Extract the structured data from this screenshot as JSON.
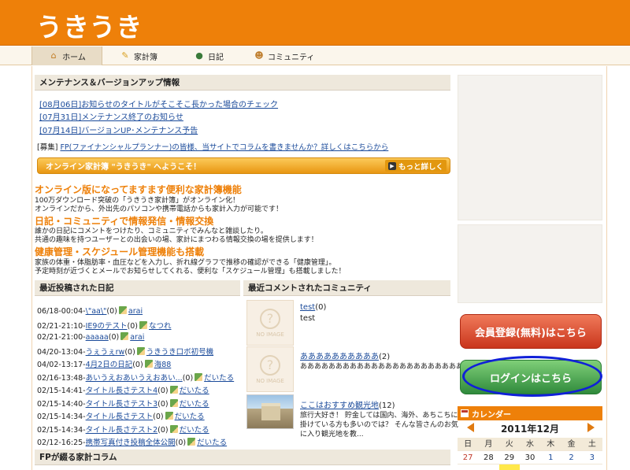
{
  "header": {
    "logo": "うきうき"
  },
  "nav": [
    {
      "label": "ホーム",
      "icon": "home-icon"
    },
    {
      "label": "家計簿",
      "icon": "pencil-icon"
    },
    {
      "label": "日記",
      "icon": "person-icon"
    },
    {
      "label": "コミュニティ",
      "icon": "community-icon"
    }
  ],
  "maintenance": {
    "title": "メンテナンス＆バージョンアップ情報",
    "items": [
      "[08月06日]お知らせのタイトルがそこそこ長かった場合のチェック",
      "[07月31日]メンテナンス終了のお知らせ",
      "[07月14日]バージョンUP･メンテナンス予告"
    ],
    "recruit_prefix": "[募集] ",
    "recruit_link": "FP(ファイナンシャルプランナー)の皆様、当サイトでコラムを書きませんか？詳しくはこちらから"
  },
  "banner": {
    "text": "オンライン家計簿 \"うきうき\" へようこそ！",
    "more": "もっと詳しく"
  },
  "features": [
    {
      "heading": "オンライン版になってますます便利な家計簿機能",
      "lines": [
        "100万ダウンロード突破の「うきうき家計簿」がオンライン化！",
        "オンラインだから、外出先のパソコンや携帯電話からも家計入力が可能です！"
      ]
    },
    {
      "heading": "日記・コミュニティで情報発信・情報交換",
      "lines": [
        "誰かの日記にコメントをつけたり、コミュニティでみんなと雑談したり。",
        "共通の趣味を持つユーザーとの出会いの場、家計にまつわる情報交換の場を提供します！"
      ]
    },
    {
      "heading": "健康管理・スケジュール管理機能も搭載",
      "lines": [
        "家族の体重・体脂肪率・血圧などを入力し、折れ線グラフで推移の確認ができる「健康管理」。",
        "予定時刻が近づくとメールでお知らせしてくれる、便利な「スケジュール管理」も搭載しました！"
      ]
    }
  ],
  "diary": {
    "title": "最近投稿された日記",
    "rows": [
      {
        "date": "06/18-00:04-",
        "title": "\\\"aa\\\"",
        "count": "(0)",
        "user": "arai"
      },
      {
        "date": "02/21-21:10-",
        "title": "IE9のテスト",
        "count": "(0)",
        "user": "なつれ"
      },
      {
        "date": "02/21-21:00-",
        "title": "aaaaa",
        "count": "(0)",
        "user": "arai"
      },
      {
        "date": "04/20-13:04-",
        "title": "うぇうぇrw",
        "count": "(0)",
        "user": "うきうき口ボ初号機"
      },
      {
        "date": "04/02-13:17-",
        "title": "4月2日の日記",
        "count": "(0)",
        "user": "海88"
      },
      {
        "date": "02/16-13:48-",
        "title": "あいうえおあいうえおあい...",
        "count": "(0)",
        "user": "だいたる"
      },
      {
        "date": "02/15-14:41-",
        "title": "タイトル長さテスト4",
        "count": "(0)",
        "user": "だいたる"
      },
      {
        "date": "02/15-14:40-",
        "title": "タイトル長さテスト3",
        "count": "(0)",
        "user": "だいたる"
      },
      {
        "date": "02/15-14:34-",
        "title": "タイトル長さテスト",
        "count": "(0)",
        "user": "だいたる"
      },
      {
        "date": "02/15-14:34-",
        "title": "タイトル長さテスト2",
        "count": "(0)",
        "user": "だいたる"
      },
      {
        "date": "02/12-16:25-",
        "title": "携帯写真付き投稿全体公開",
        "count": "(0)",
        "user": "だいたる"
      }
    ]
  },
  "community": {
    "title": "最近コメントされたコミュニティ",
    "no_image": "NO IMAGE",
    "items": [
      {
        "name": "test",
        "count": "(0)",
        "desc": "test"
      },
      {
        "name": "ああああああああああ",
        "count": "(2)",
        "desc": "ああああああああああああああああああああああああ"
      },
      {
        "name": "ここはおすすめ観光地",
        "count": "(12)",
        "desc1": "旅行大好き！ 貯金しては国内、海外、あちこちに出",
        "desc2": "掛けている方も多いのでは？ そんな皆さんのお気",
        "desc3": "に入り観光地を教..."
      }
    ]
  },
  "column": {
    "title": "FPが綴る家計コラム"
  },
  "sidebar": {
    "register": "会員登録(無料)はこちら",
    "login": "ログインはこちら"
  },
  "calendar": {
    "label": "カレンダー",
    "month": "2011年12月",
    "dow": [
      "日",
      "月",
      "火",
      "水",
      "木",
      "金",
      "土"
    ],
    "week1": [
      "27",
      "28",
      "29",
      "30",
      "1",
      "2",
      "3"
    ]
  },
  "colors": {
    "brand": "#ee8009",
    "register": "#d9452a",
    "login": "#3f9e4a",
    "highlight": "#1020d8"
  }
}
